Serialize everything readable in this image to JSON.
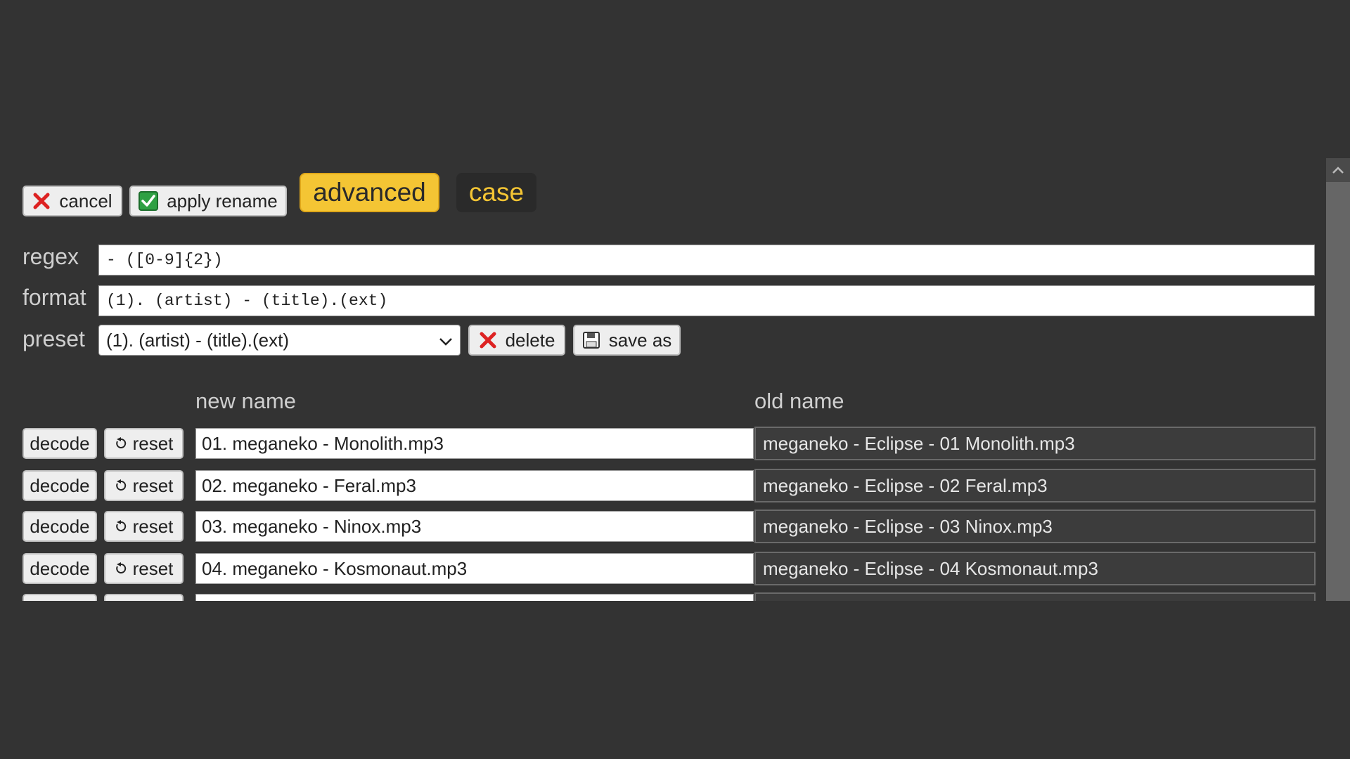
{
  "toolbar": {
    "cancel_label": "cancel",
    "apply_label": "apply rename",
    "cancel_icon": "close-x-icon",
    "apply_icon": "checkbox-check-icon"
  },
  "tabs": {
    "advanced": "advanced",
    "case": "case",
    "active": "advanced",
    "active_color": "#f4c534"
  },
  "form": {
    "regex_label": "regex",
    "regex_value": "- ([0-9]{2})",
    "format_label": "format",
    "format_value": "(1). (artist) - (title).(ext)",
    "preset_label": "preset",
    "preset_value": "(1). (artist) - (title).(ext)",
    "delete_label": "delete",
    "save_as_label": "save as"
  },
  "table": {
    "new_name_header": "new name",
    "old_name_header": "old name",
    "decode_label": "decode",
    "reset_label": "reset",
    "rows": [
      {
        "new_name": "01. meganeko - Monolith.mp3",
        "old_name": "meganeko - Eclipse - 01 Monolith.mp3"
      },
      {
        "new_name": "02. meganeko - Feral.mp3",
        "old_name": "meganeko - Eclipse - 02 Feral.mp3"
      },
      {
        "new_name": "03. meganeko - Ninox.mp3",
        "old_name": "meganeko - Eclipse - 03 Ninox.mp3"
      },
      {
        "new_name": "04. meganeko - Kosmonaut.mp3",
        "old_name": "meganeko - Eclipse - 04 Kosmonaut.mp3"
      },
      {
        "new_name": "",
        "old_name": ""
      }
    ]
  }
}
